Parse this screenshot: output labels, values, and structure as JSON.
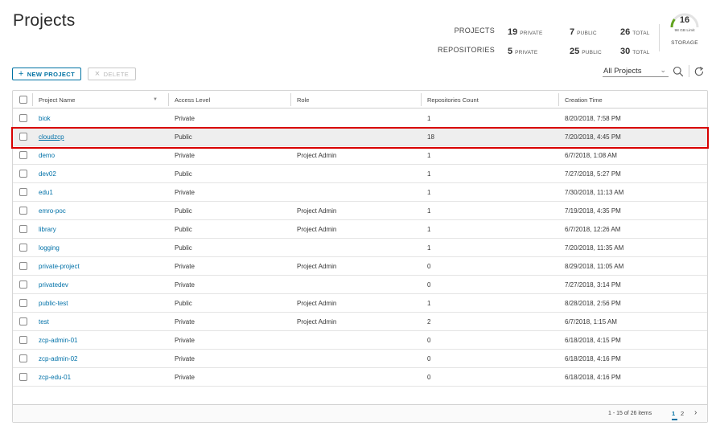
{
  "page": {
    "title": "Projects"
  },
  "summary": {
    "projects_label": "PROJECTS",
    "repositories_label": "REPOSITORIES",
    "projects": {
      "private_count": "19",
      "public_count": "7",
      "total_count": "26"
    },
    "repositories": {
      "private_count": "5",
      "public_count": "25",
      "total_count": "30"
    },
    "private_caption": "PRIVATE",
    "public_caption": "PUBLIC",
    "total_caption": "TOTAL",
    "storage": {
      "value": "16",
      "limit": "98 GB Limit",
      "label": "STORAGE",
      "gauge_color": "#62a420"
    }
  },
  "toolbar": {
    "new_project_label": "NEW PROJECT",
    "delete_label": "DELETE",
    "filter_value": "All Projects",
    "search_icon": "search-icon",
    "refresh_icon": "refresh-icon"
  },
  "grid": {
    "columns": [
      "Project Name",
      "Access Level",
      "Role",
      "Repositories Count",
      "Creation Time"
    ],
    "rows": [
      {
        "name": "biok",
        "access": "Private",
        "role": "",
        "count": "1",
        "time": "8/20/2018, 7:58 PM"
      },
      {
        "name": "cloudzcp",
        "access": "Public",
        "role": "",
        "count": "18",
        "time": "7/20/2018, 4:45 PM"
      },
      {
        "name": "demo",
        "access": "Private",
        "role": "Project Admin",
        "count": "1",
        "time": "6/7/2018, 1:08 AM"
      },
      {
        "name": "dev02",
        "access": "Public",
        "role": "",
        "count": "1",
        "time": "7/27/2018, 5:27 PM"
      },
      {
        "name": "edu1",
        "access": "Private",
        "role": "",
        "count": "1",
        "time": "7/30/2018, 11:13 AM"
      },
      {
        "name": "emro-poc",
        "access": "Public",
        "role": "Project Admin",
        "count": "1",
        "time": "7/19/2018, 4:35 PM"
      },
      {
        "name": "library",
        "access": "Public",
        "role": "Project Admin",
        "count": "1",
        "time": "6/7/2018, 12:26 AM"
      },
      {
        "name": "logging",
        "access": "Public",
        "role": "",
        "count": "1",
        "time": "7/20/2018, 11:35 AM"
      },
      {
        "name": "private-project",
        "access": "Private",
        "role": "Project Admin",
        "count": "0",
        "time": "8/29/2018, 11:05 AM"
      },
      {
        "name": "privatedev",
        "access": "Private",
        "role": "",
        "count": "0",
        "time": "7/27/2018, 3:14 PM"
      },
      {
        "name": "public-test",
        "access": "Public",
        "role": "Project Admin",
        "count": "1",
        "time": "8/28/2018, 2:56 PM"
      },
      {
        "name": "test",
        "access": "Private",
        "role": "Project Admin",
        "count": "2",
        "time": "6/7/2018, 1:15 AM"
      },
      {
        "name": "zcp-admin-01",
        "access": "Private",
        "role": "",
        "count": "0",
        "time": "6/18/2018, 4:15 PM"
      },
      {
        "name": "zcp-admin-02",
        "access": "Private",
        "role": "",
        "count": "0",
        "time": "6/18/2018, 4:16 PM"
      },
      {
        "name": "zcp-edu-01",
        "access": "Private",
        "role": "",
        "count": "0",
        "time": "6/18/2018, 4:16 PM"
      }
    ],
    "footer": {
      "range_text": "1 - 15 of 26 items",
      "pages": [
        "1",
        "2"
      ],
      "current_page": "1"
    }
  },
  "colors": {
    "accent": "#0072a3",
    "link": "#0071a8",
    "highlight_border": "#d80000"
  }
}
